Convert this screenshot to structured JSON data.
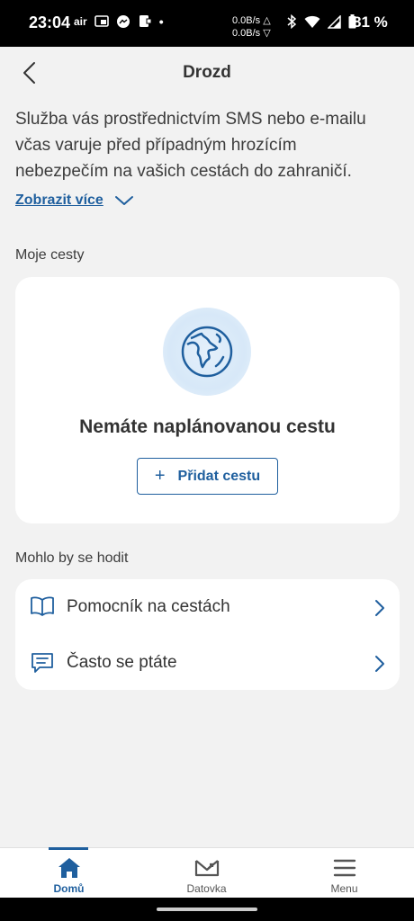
{
  "status_bar": {
    "time": "23:04",
    "air_label": "air",
    "net_up": "0.0B/s △",
    "net_down": "0.0B/s ▽",
    "battery": "81 %"
  },
  "header": {
    "title": "Drozd"
  },
  "intro": {
    "text": "Služba vás prostřednictvím SMS nebo e-mailu včas varuje před případným hrozícím nebezpečím na vašich cestách do zahraničí.",
    "show_more": "Zobrazit více"
  },
  "trips": {
    "section_label": "Moje cesty",
    "empty_title": "Nemáte naplánovanou cestu",
    "add_button_icon": "+",
    "add_button_label": "Přidat cestu"
  },
  "useful": {
    "section_label": "Mohlo by se hodit",
    "items": [
      {
        "label": "Pomocník na cestách",
        "icon": "book-icon"
      },
      {
        "label": "Často se ptáte",
        "icon": "chat-icon"
      }
    ]
  },
  "bottom_nav": {
    "items": [
      {
        "label": "Domů",
        "icon": "home-icon",
        "active": true
      },
      {
        "label": "Datovka",
        "icon": "datovka-icon",
        "active": false
      },
      {
        "label": "Menu",
        "icon": "menu-icon",
        "active": false
      }
    ]
  },
  "colors": {
    "accent": "#1f5f9e",
    "background": "#f2f2f2",
    "card": "#ffffff"
  }
}
